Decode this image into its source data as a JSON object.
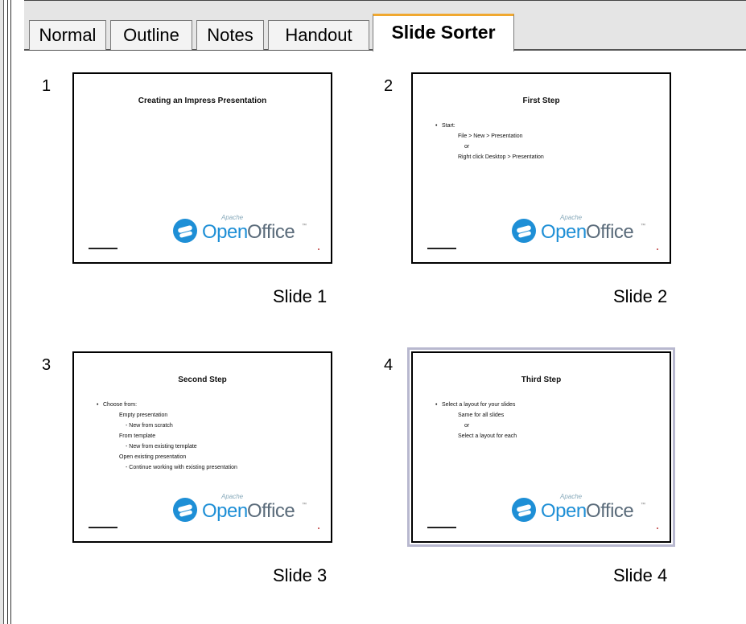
{
  "tabs": [
    {
      "label": "Normal"
    },
    {
      "label": "Outline"
    },
    {
      "label": "Notes"
    },
    {
      "label": "Handout"
    },
    {
      "label": "Slide Sorter"
    }
  ],
  "active_tab": "Slide Sorter",
  "colors": {
    "active_tab_accent": "#f0a830",
    "logo_blue": "#1e8fd6",
    "selection": "#b8b8cf"
  },
  "logo": {
    "apache": "Apache",
    "open": "Open",
    "office": "Office",
    "tm": "™"
  },
  "slides": [
    {
      "number": "1",
      "label": "Slide 1",
      "title": "Creating an Impress Presentation",
      "lines": []
    },
    {
      "number": "2",
      "label": "Slide 2",
      "title": "First Step",
      "lines": [
        {
          "lvl": 1,
          "text": "Start:"
        },
        {
          "lvl": 2,
          "text": "File > New > Presentation"
        },
        {
          "lvl": 3,
          "text": "or"
        },
        {
          "lvl": 2,
          "text": "Right click Desktop > Presentation"
        }
      ]
    },
    {
      "number": "3",
      "label": "Slide 3",
      "title": "Second Step",
      "lines": [
        {
          "lvl": 1,
          "text": "Choose from:"
        },
        {
          "lvl": 2,
          "text": "Empty presentation"
        },
        {
          "lvl": 3,
          "text": "- New from scratch"
        },
        {
          "lvl": 2,
          "text": "From template"
        },
        {
          "lvl": 3,
          "text": "- New from existing template"
        },
        {
          "lvl": 2,
          "text": "Open existing presentation"
        },
        {
          "lvl": 3,
          "text": "- Continue working with existing presentation"
        }
      ]
    },
    {
      "number": "4",
      "label": "Slide 4",
      "title": "Third Step",
      "selected": true,
      "lines": [
        {
          "lvl": 1,
          "text": "Select a layout for your slides"
        },
        {
          "lvl": 2,
          "text": "Same for all slides"
        },
        {
          "lvl": 3,
          "text": "or"
        },
        {
          "lvl": 2,
          "text": "Select a layout for each"
        }
      ]
    }
  ]
}
